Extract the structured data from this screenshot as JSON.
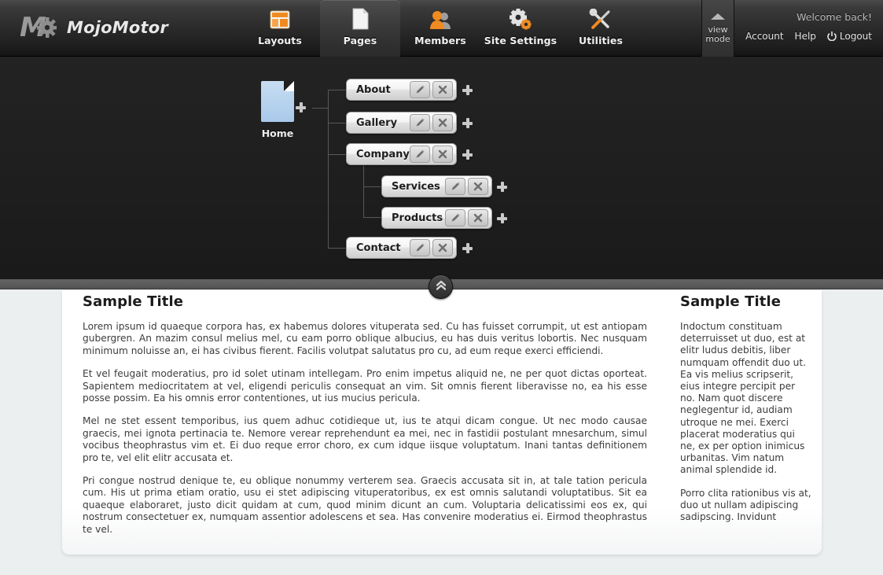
{
  "brand": {
    "name": "MojoMotor",
    "logo_icon": "mojomotor-m-gear-logo"
  },
  "nav": {
    "items": [
      {
        "label": "Layouts",
        "icon": "layouts-icon",
        "active": false
      },
      {
        "label": "Pages",
        "icon": "page-document-icon",
        "active": true
      },
      {
        "label": "Members",
        "icon": "members-people-icon",
        "active": false
      },
      {
        "label": "Site Settings",
        "icon": "gears-icon",
        "active": false
      },
      {
        "label": "Utilities",
        "icon": "wrench-screwdriver-icon",
        "active": false
      }
    ]
  },
  "view_mode": {
    "line1": "view",
    "line2": "mode",
    "icon": "triangle-up-icon"
  },
  "user": {
    "welcome": "Welcome back!",
    "links": [
      {
        "label": "Account",
        "icon": ""
      },
      {
        "label": "Help",
        "icon": ""
      },
      {
        "label": "Logout",
        "icon": "power-icon"
      }
    ]
  },
  "tree": {
    "root": {
      "label": "Home",
      "icon": "page-icon"
    },
    "add_icon": "plus-icon",
    "edit_icon": "pencil-icon",
    "delete_icon": "x-close-icon",
    "nodes": [
      {
        "label": "About",
        "level": 1
      },
      {
        "label": "Gallery",
        "level": 1
      },
      {
        "label": "Company",
        "level": 1
      },
      {
        "label": "Services",
        "level": 2
      },
      {
        "label": "Products",
        "level": 2
      },
      {
        "label": "Contact",
        "level": 1
      }
    ]
  },
  "collapse_button": {
    "icon": "double-chevron-up-icon"
  },
  "content": {
    "main": {
      "title": "Sample Title",
      "paragraphs": [
        "Lorem ipsum id quaeque corpora has, ex habemus dolores vituperata sed. Cu has fuisset corrumpit, ut est antiopam gubergren. An mazim consul melius mel, cu eam porro oblique albucius, eu has duis veritus lobortis. Nec nusquam minimum noluisse an, ei has civibus fierent. Facilis volutpat salutatus pro cu, ad eum reque exerci efficiendi.",
        "Et vel feugait moderatius, pro id solet utinam intellegam. Pro enim impetus aliquid ne, ne per quot dictas oporteat. Sapientem mediocritatem at vel, eligendi periculis consequat an vim. Sit omnis fierent liberavisse no, ea his esse posse possim. Ea his omnis error contentiones, ut ius mucius pericula.",
        "Mel ne stet essent temporibus, ius quem adhuc cotidieque ut, ius te atqui dicam congue. Ut nec modo causae graecis, mei ignota pertinacia te. Nemore verear reprehendunt ea mei, nec in fastidii postulant mnesarchum, simul vocibus theophrastus vim et. Ei duo reque error choro, ex cum idque iisque voluptatum. Inani tantas definitionem pro te, vel elit elitr accusata et.",
        "Pri congue nostrud denique te, eu oblique nonummy verterem sea. Graecis accusata sit in, at tale tation pericula cum. His ut prima etiam oratio, usu ei stet adipiscing vituperatoribus, ex est omnis salutandi voluptatibus. Sit ea quaeque elaboraret, justo dicit quidam at cum, quod minim dicunt an cum. Voluptaria delicatissimi eos ex, qui nostrum consectetuer ex, numquam assentior adolescens et sea. Has convenire moderatius ei. Eirmod theophrastus te vel."
      ]
    },
    "sidebar": {
      "title": "Sample Title",
      "paragraphs": [
        "Indoctum constituam deterruisset ut duo, est at elitr ludus debitis, liber numquam offendit duo ut. Ea vis melius scripserit, eius integre percipit per no. Nam quot discere neglegentur id, audiam utroque ne mei. Exerci placerat moderatius qui ne, ex per option inimicus urbanitas. Vim natum animal splendide id.",
        "Porro clita rationibus vis at, duo ut nullam adipiscing sadipscing. Invidunt"
      ]
    }
  },
  "colors": {
    "header_dark": "#2a2a2a",
    "panel_dark": "#1e1e1e",
    "gray_band": "#5b5b5b",
    "stage_bg": "#eceff0",
    "accent_orange": "#ef8b21",
    "page_icon_blue": "#a9c9ea"
  }
}
